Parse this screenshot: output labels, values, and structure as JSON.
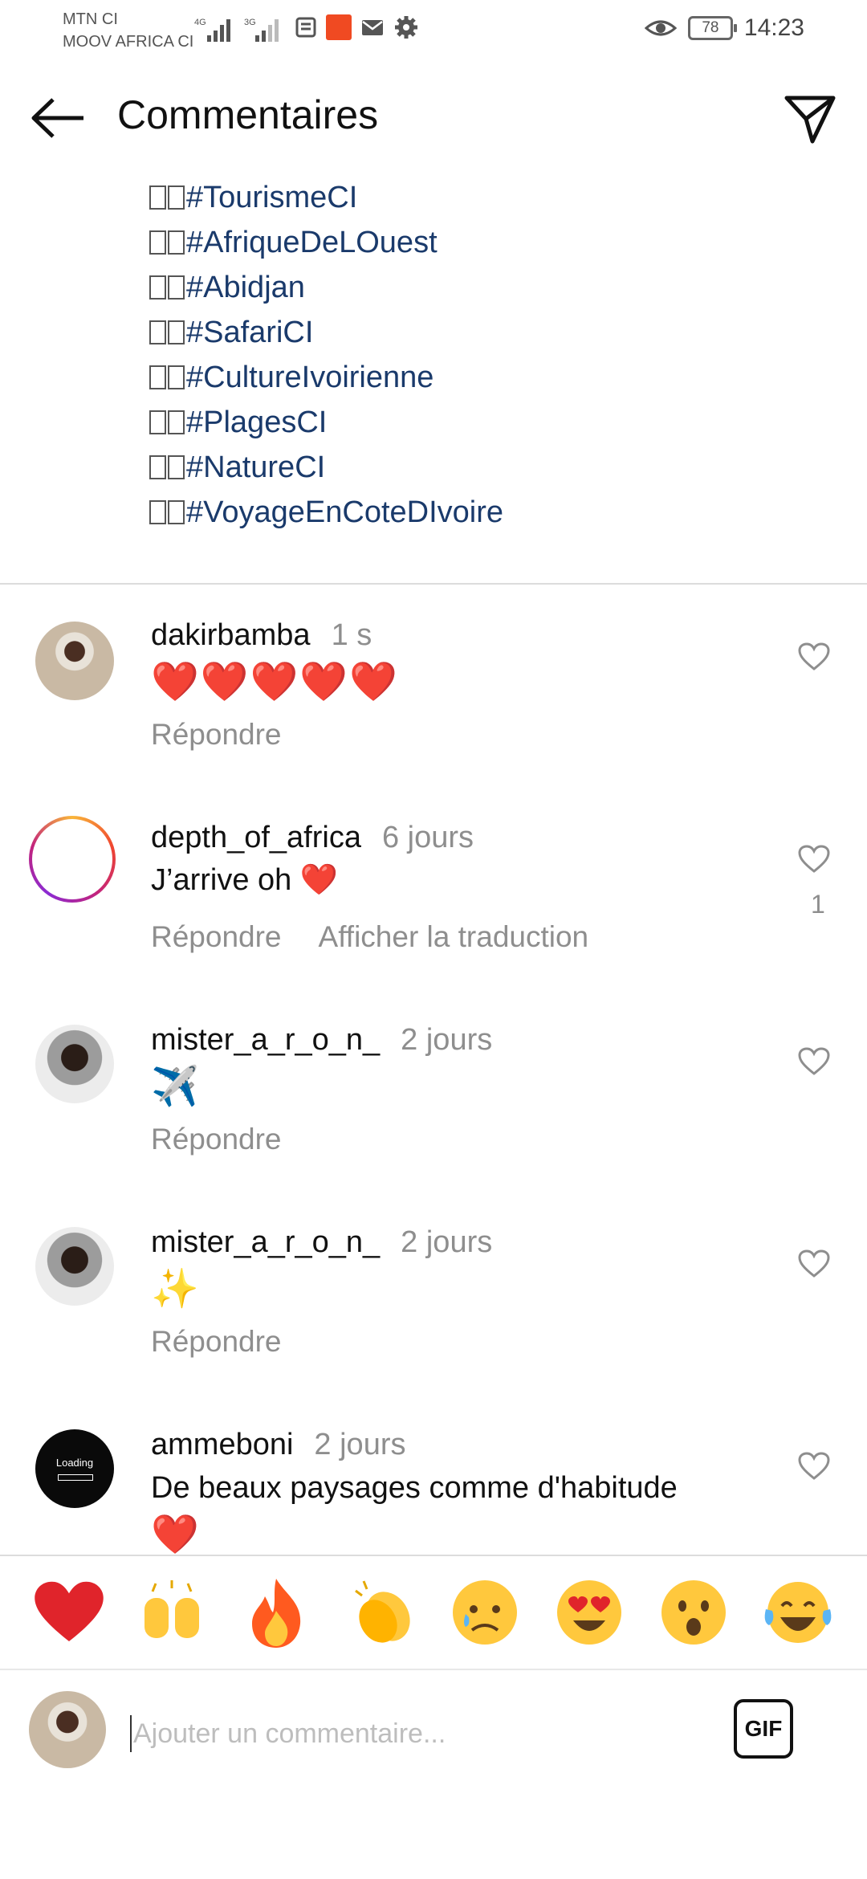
{
  "status_bar": {
    "carrier1": "MTN CI",
    "carrier2": "MOOV AFRICA CI",
    "sig1_label": "4G",
    "sig2_label": "3G",
    "battery": "78",
    "time": "14:23"
  },
  "header": {
    "title": "Commentaires"
  },
  "caption_hashtags": [
    "#TourismeCI",
    "#AfriqueDeLOuest",
    "#Abidjan",
    "#SafariCI",
    "#CultureIvoirienne",
    "#PlagesCI",
    "#NatureCI",
    "#VoyageEnCoteDIvoire"
  ],
  "comments": [
    {
      "user": "dakirbamba",
      "time": "1 s",
      "text": "❤️❤️❤️❤️❤️",
      "reply": "Répondre"
    },
    {
      "user": "depth_of_africa",
      "time": "6 jours",
      "text": "J’arrive oh ❤️",
      "reply": "Répondre",
      "translate": "Afficher la traduction",
      "likes": "1"
    },
    {
      "user": "mister_a_r_o_n_",
      "time": "2 jours",
      "text": "✈️",
      "reply": "Répondre"
    },
    {
      "user": "mister_a_r_o_n_",
      "time": "2 jours",
      "text": "✨",
      "reply": "Répondre"
    },
    {
      "user": "ammeboni",
      "time": "2 jours",
      "text": "De beaux paysages comme d'habitude",
      "text2": "❤️",
      "avatar_label": "Loading"
    }
  ],
  "reactions": [
    "heart",
    "raising-hands",
    "fire",
    "clapping-hands",
    "sad-face",
    "heart-eyes",
    "surprised-face",
    "tears-of-joy"
  ],
  "composer": {
    "placeholder": "Ajouter un commentaire...",
    "gif_label": "GIF"
  },
  "colors": {
    "hashtag": "#1a3a6b",
    "meta_gray": "#8e8e8e",
    "heart_red": "#e0242b"
  }
}
